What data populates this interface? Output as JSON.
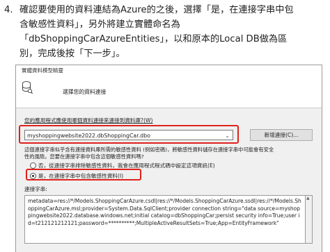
{
  "instruction": {
    "number": "4.",
    "lines": [
      "確認要使用的資料連結為Azure的之後，選擇「是，在連接字串中包",
      "含敏感性資料」，另外將建立實體命名為",
      "「dbShoppingCarAzureEntities」，以和原本的Local DB做為區",
      "別，完成後按「下一步」。"
    ]
  },
  "wizard": {
    "window_title": "實體資料模型精靈",
    "header_title": "選擇您的資料連接",
    "connection_question": "您的應用程式應使用哪個資料連接來連接到資料庫?(W)",
    "selected_connection": "myshoppingwebsite2022.dbShoppingCar.dbo",
    "new_connection_button": "新增連接(C)...",
    "sensitive_info_text": [
      "這個連接字串似乎含有連接資料庫所需的敏感性資料 (例如密碼)，將敏感性資料儲存在連接字串中可能會有安全",
      "性的風險。您要在連接字串中包含這個敏感性資料嗎?"
    ],
    "radio_options": [
      {
        "label": "否，從連接字串排除敏感性資料，我會在應用程式程式碼中設定這項資訊(E)",
        "selected": false
      },
      {
        "label": "是，在連接字串中包含敏感性資料(I)",
        "selected": true
      }
    ],
    "connection_string_label": "連接字串:",
    "connection_string": "metadata=res://*/Models.ShoppingCarAzure.csdl|res://*/Models.ShoppingCarAzure.ssdl|res://*/Models.ShoppingCarAzure.msl;provider=System.Data.SqlClient;provider connection string=\"data source=myshoppingwebsite2022.database.windows.net;initial catalog=dbShoppingCar;persist security info=True;user id=t212121212121;password=**********;MultipleActiveResultSets=True;App=EntityFramework\""
  },
  "colors": {
    "highlight_red": "#e0201b",
    "dialog_bg": "#f0f0f0"
  }
}
